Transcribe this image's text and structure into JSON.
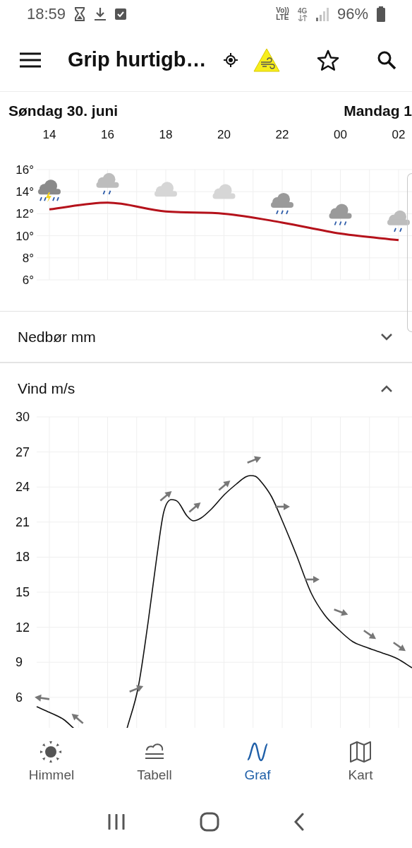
{
  "status_bar": {
    "time": "18:59",
    "volte_top": "Vo))",
    "volte_bottom": "LTE",
    "data_type": "4G",
    "battery": "96%"
  },
  "app_bar": {
    "title": "Grip hurtigb…"
  },
  "forecast": {
    "days": [
      {
        "label": "Søndag 30. juni"
      },
      {
        "label": "Mandag 1"
      }
    ],
    "temperature": {
      "symbols": [
        {
          "kind": "thunder"
        },
        {
          "kind": "light_rain"
        },
        {
          "kind": "cloud"
        },
        {
          "kind": "cloud"
        },
        {
          "kind": "rain"
        },
        {
          "kind": "rain"
        },
        {
          "kind": "light_rain"
        }
      ],
      "chart_data": {
        "type": "line",
        "categories": [
          "14",
          "16",
          "18",
          "20",
          "22",
          "00",
          "02"
        ],
        "series": [
          {
            "color": "#b5121b",
            "values": [
              12.4,
              13.0,
              12.2,
              12.0,
              11.2,
              10.2,
              9.6
            ]
          }
        ],
        "ylim": [
          6,
          16
        ],
        "grid": true,
        "yticks": [
          {
            "value": 16,
            "label": "16°"
          },
          {
            "value": 14,
            "label": "14°"
          },
          {
            "value": 12,
            "label": "12°"
          },
          {
            "value": 10,
            "label": "10°"
          },
          {
            "value": 8,
            "label": "8°"
          },
          {
            "value": 6,
            "label": "6°"
          }
        ]
      }
    },
    "sections": [
      {
        "title": "Nedbør mm",
        "expanded": false
      },
      {
        "title": "Vind m/s",
        "expanded": true,
        "y_labels": [
          "30",
          "27",
          "24",
          "21",
          "18",
          "15",
          "12",
          "9",
          "6"
        ],
        "wind_arrows": [
          {
            "kind": "west"
          },
          {
            "kind": "northwest"
          },
          {
            "kind": "eastnortheast"
          },
          {
            "kind": "northeast"
          },
          {
            "kind": "northeast"
          },
          {
            "kind": "northeast"
          },
          {
            "kind": "eastnortheast"
          },
          {
            "kind": "east"
          },
          {
            "kind": "east"
          },
          {
            "kind": "eastsoutheast"
          },
          {
            "kind": "southeast"
          },
          {
            "kind": "southeast"
          }
        ]
      }
    ]
  },
  "bottom_nav": [
    {
      "label": "Himmel",
      "kind": "sun",
      "selected": false
    },
    {
      "label": "Tabell",
      "kind": "table",
      "selected": false
    },
    {
      "label": "Graf",
      "kind": "graph",
      "selected": true
    },
    {
      "label": "Kart",
      "kind": "map",
      "selected": false
    }
  ]
}
